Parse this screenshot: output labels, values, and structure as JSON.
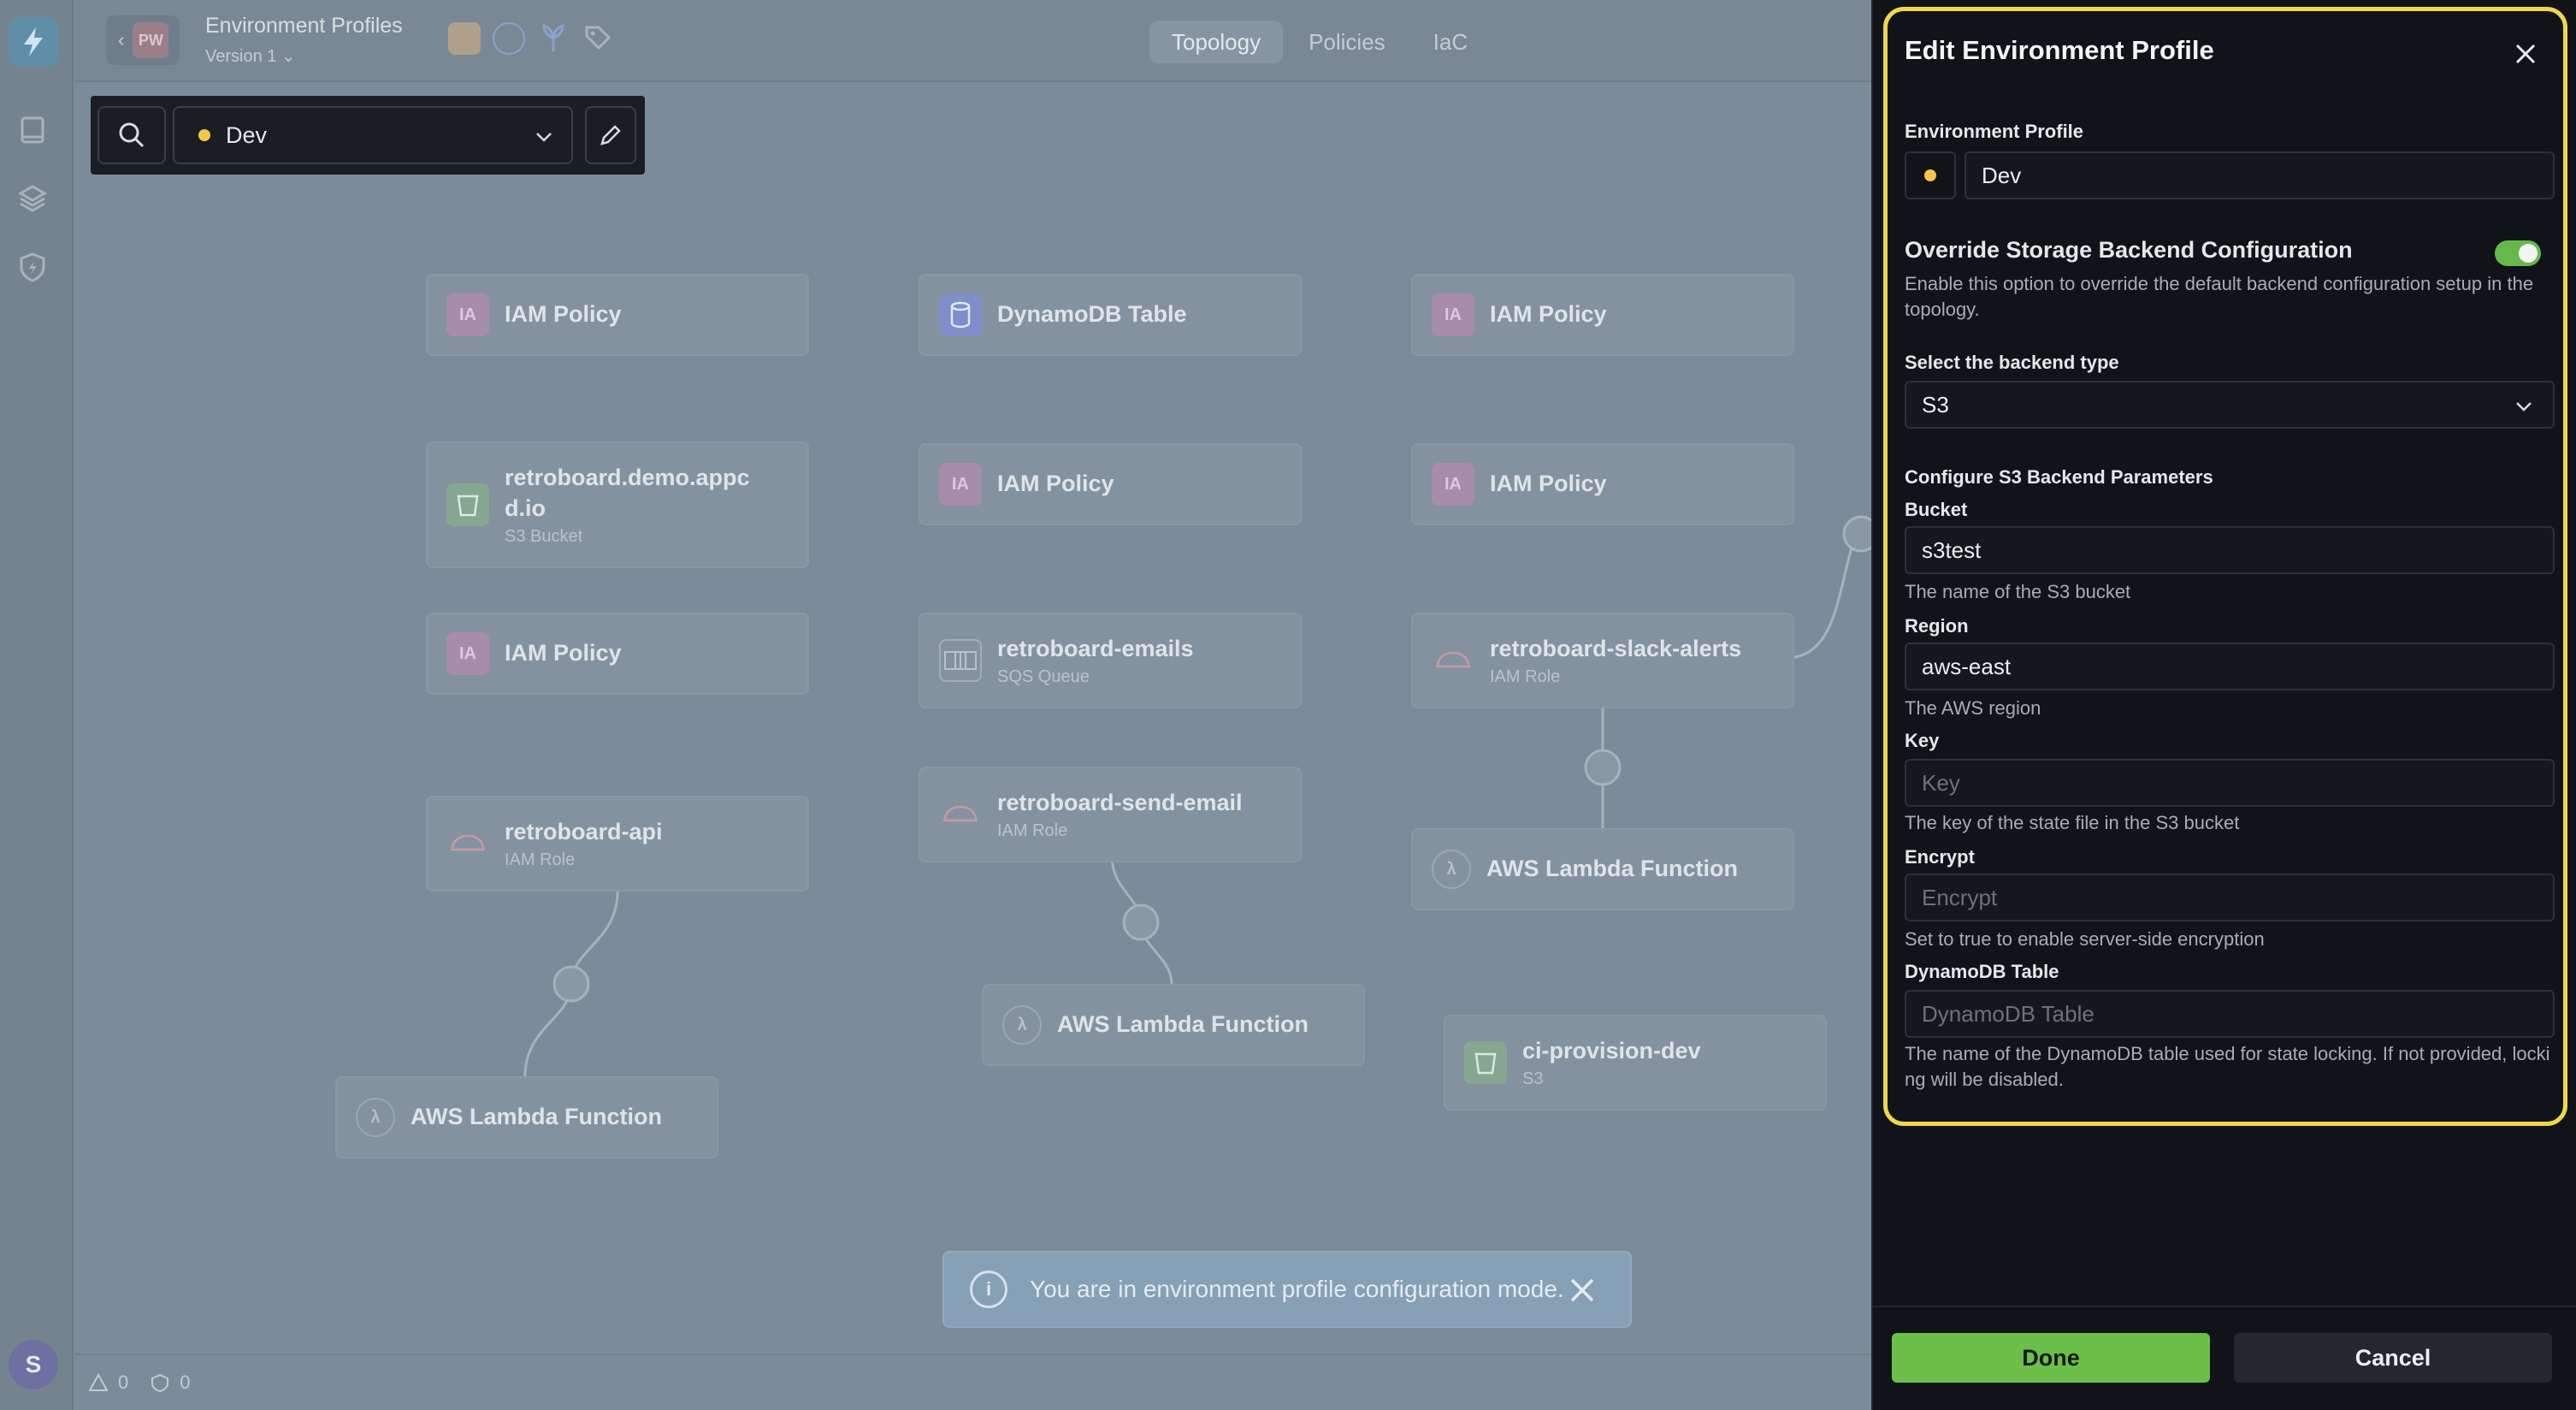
{
  "header": {
    "pw_badge": "PW",
    "title": "Environment Profiles",
    "version": "Version 1",
    "tabs": [
      {
        "label": "Topology",
        "active": true
      },
      {
        "label": "Policies",
        "active": false
      },
      {
        "label": "IaC",
        "active": false
      }
    ]
  },
  "toolbar": {
    "env_name": "Dev",
    "env_color": "#f1c84b"
  },
  "nodes": [
    {
      "label": "IAM Policy",
      "icon": "IA",
      "type": "ia"
    },
    {
      "label": "DynamoDB Table",
      "icon": "",
      "type": "ddb"
    },
    {
      "label": "IAM Policy",
      "icon": "IA",
      "type": "ia"
    },
    {
      "label": "retroboard.demo.appcd.io",
      "sub": "S3 Bucket",
      "icon": "",
      "type": "s3"
    },
    {
      "label": "IAM Policy",
      "icon": "IA",
      "type": "ia"
    },
    {
      "label": "IAM Policy",
      "icon": "IA",
      "type": "ia"
    },
    {
      "label": "IAM Policy",
      "icon": "IA",
      "type": "ia"
    },
    {
      "label": "retroboard-emails",
      "sub": "SQS Queue",
      "icon": "",
      "type": "sqs"
    },
    {
      "label": "retroboard-slack-alerts",
      "sub": "IAM Role",
      "icon": "",
      "type": "role"
    },
    {
      "label": "retroboard-api",
      "sub": "IAM Role",
      "icon": "",
      "type": "role"
    },
    {
      "label": "retroboard-send-email",
      "sub": "IAM Role",
      "icon": "",
      "type": "role"
    },
    {
      "label": "AWS Lambda Function",
      "icon": "λ",
      "type": "lambda"
    },
    {
      "label": "AWS Lambda Function",
      "icon": "λ",
      "type": "lambda"
    },
    {
      "label": "ci-provision-dev",
      "sub": "S3",
      "icon": "",
      "type": "s3"
    },
    {
      "label": "AWS Lambda Function",
      "icon": "λ",
      "type": "lambda"
    }
  ],
  "toast": {
    "message": "You are in environment profile configuration mode."
  },
  "status": {
    "warnings": "0",
    "errors": "0"
  },
  "user": {
    "initial": "S"
  },
  "panel": {
    "title": "Edit Environment Profile",
    "env_profile_label": "Environment Profile",
    "env_profile_value": "Dev",
    "override_label": "Override Storage Backend Configuration",
    "override_help": "Enable this option to override the default backend configuration setup in the topology.",
    "override_enabled": true,
    "backend_type_label": "Select the backend type",
    "backend_type_value": "S3",
    "s3_section_label": "Configure S3 Backend Parameters",
    "bucket": {
      "label": "Bucket",
      "value": "s3test",
      "placeholder": "",
      "help": "The name of the S3 bucket"
    },
    "region": {
      "label": "Region",
      "value": "aws-east",
      "placeholder": "",
      "help": "The AWS region"
    },
    "key": {
      "label": "Key",
      "value": "",
      "placeholder": "Key",
      "help": "The key of the state file in the S3 bucket"
    },
    "encrypt": {
      "label": "Encrypt",
      "value": "",
      "placeholder": "Encrypt",
      "help": "Set to true to enable server-side encryption"
    },
    "dynamodb": {
      "label": "DynamoDB Table",
      "value": "",
      "placeholder": "DynamoDB Table",
      "help": "The name of the DynamoDB table used for state locking. If not provided, locking will be disabled."
    },
    "done_label": "Done",
    "cancel_label": "Cancel"
  },
  "colors": {
    "accent_green": "#6cc04a",
    "highlight_yellow": "#f0d64c"
  }
}
